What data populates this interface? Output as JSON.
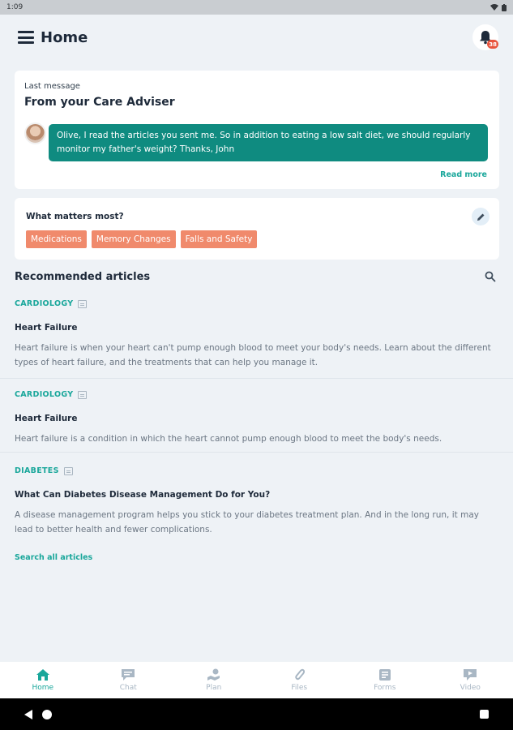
{
  "status_bar": {
    "time": "1:09"
  },
  "header": {
    "title": "Home",
    "notification_count": "38"
  },
  "last_message": {
    "kicker": "Last message",
    "title": "From your Care Adviser",
    "text": "Olive, I read the articles you sent me. So in addition to eating a low salt diet, we should regularly monitor my father's weight? Thanks, John",
    "read_more": "Read more"
  },
  "matters": {
    "title": "What matters most?",
    "chips": [
      "Medications",
      "Memory Changes",
      "Falls and Safety"
    ]
  },
  "recommended": {
    "title": "Recommended articles",
    "articles": [
      {
        "category": "CARDIOLOGY",
        "title": "Heart Failure",
        "description": "Heart failure is when your heart can't pump enough blood to meet your body's needs. Learn about the different types of heart failure, and the treatments that can help you manage it."
      },
      {
        "category": "CARDIOLOGY",
        "title": "Heart Failure",
        "description": "Heart failure is a condition in which the heart cannot pump enough blood to meet the body's needs."
      },
      {
        "category": "DIABETES",
        "title": "What Can Diabetes Disease Management Do for You?",
        "description": "A disease management program helps you stick to your diabetes treatment plan. And in the long run, it may lead to better health and fewer complications."
      }
    ],
    "search_all": "Search all articles"
  },
  "bottom_nav": [
    {
      "label": "Home",
      "icon": "home-icon"
    },
    {
      "label": "Chat",
      "icon": "chat-icon"
    },
    {
      "label": "Plan",
      "icon": "plan-icon"
    },
    {
      "label": "Files",
      "icon": "files-icon"
    },
    {
      "label": "Forms",
      "icon": "forms-icon"
    },
    {
      "label": "Video",
      "icon": "video-icon"
    }
  ],
  "colors": {
    "teal": "#0f8b80",
    "accent": "#1aa79b",
    "chip": "#f08a6c",
    "badge": "#e8543d"
  }
}
